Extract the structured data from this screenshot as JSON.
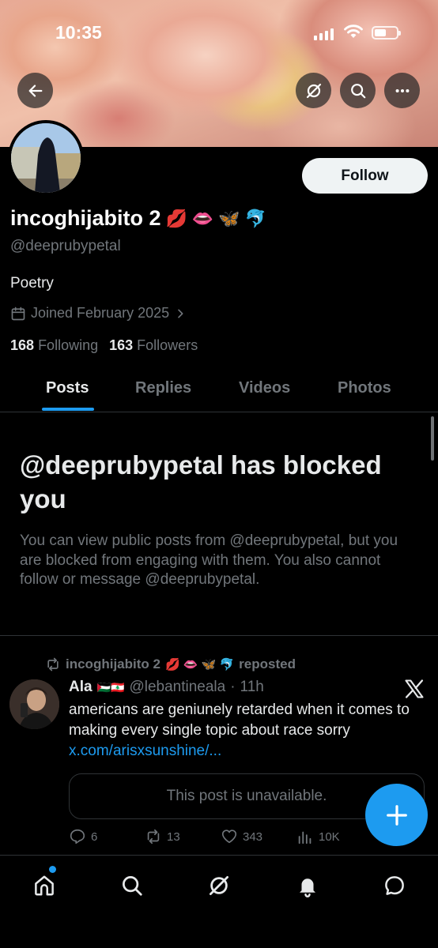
{
  "status_bar": {
    "time": "10:35"
  },
  "profile": {
    "display_name": "incoghijabito 2",
    "name_emojis": [
      "💋",
      "👄",
      "🦋",
      "🐬"
    ],
    "handle": "@deeprubypetal",
    "bio": "Poetry",
    "joined": "Joined February 2025",
    "following_count": "168",
    "following_label": "Following",
    "followers_count": "163",
    "followers_label": "Followers",
    "follow_button": "Follow"
  },
  "tabs": [
    {
      "label": "Posts",
      "active": true
    },
    {
      "label": "Replies",
      "active": false
    },
    {
      "label": "Videos",
      "active": false
    },
    {
      "label": "Photos",
      "active": false
    }
  ],
  "blocked": {
    "title": "@deeprubypetal has blocked you",
    "description": "You can view public posts from @deeprubypetal, but you are blocked from engaging with them. You also cannot follow or message @deeprubypetal."
  },
  "post": {
    "repost_by": "incoghijabito 2",
    "repost_emojis": "💋 👄 🦋 🐬",
    "repost_label": "reposted",
    "author_name": "Ala",
    "author_flags": "🇵🇸🇱🇧",
    "author_handle": "@lebantineala",
    "time": "11h",
    "text": "americans are geniunely retarded when it comes to making every single topic about race sorry ",
    "link": "x.com/arisxsunshine/...",
    "quote_unavailable": "This post is unavailable.",
    "replies": "6",
    "reposts": "13",
    "likes": "343",
    "views": "10K"
  },
  "colors": {
    "accent": "#1d9bf0",
    "background": "#000000",
    "secondary_text": "#71767b",
    "border": "#2f3336"
  }
}
